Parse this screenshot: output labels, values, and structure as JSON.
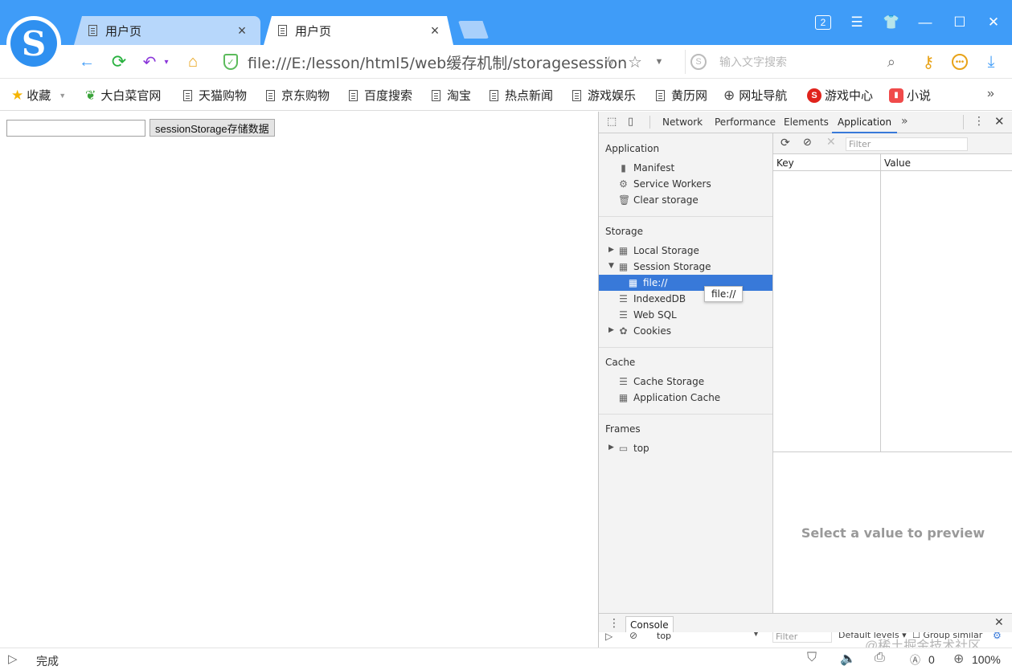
{
  "browser": {
    "tabs": [
      {
        "label": "用户页",
        "close": "×"
      },
      {
        "label": "用户页",
        "close": "×"
      }
    ],
    "window_count": "2",
    "address": {
      "url": "file:///E:/lesson/html5/web缓存机制/storagesession"
    },
    "search": {
      "placeholder": "输入文字搜索"
    },
    "bookmarks": [
      {
        "label": "收藏"
      },
      {
        "label": "大白菜官网"
      },
      {
        "label": "天猫购物"
      },
      {
        "label": "京东购物"
      },
      {
        "label": "百度搜索"
      },
      {
        "label": "淘宝"
      },
      {
        "label": "热点新闻"
      },
      {
        "label": "游戏娱乐"
      },
      {
        "label": "黄历网"
      },
      {
        "label": "网址导航"
      },
      {
        "label": "游戏中心"
      },
      {
        "label": "小说"
      }
    ],
    "status": {
      "text": "完成",
      "ad_count": "0",
      "zoom": "100%"
    }
  },
  "page": {
    "button_label": "sessionStorage存储数据",
    "input_value": ""
  },
  "devtools": {
    "tabs": [
      "Network",
      "Performance",
      "Elements",
      "Application"
    ],
    "active_tab": "Application",
    "sidebar": {
      "application": {
        "heading": "Application",
        "items": [
          "Manifest",
          "Service Workers",
          "Clear storage"
        ]
      },
      "storage": {
        "heading": "Storage",
        "items": [
          "Local Storage",
          "Session Storage",
          "file://",
          "IndexedDB",
          "Web SQL",
          "Cookies"
        ]
      },
      "cache": {
        "heading": "Cache",
        "items": [
          "Cache Storage",
          "Application Cache"
        ]
      },
      "frames": {
        "heading": "Frames",
        "items": [
          "top"
        ]
      }
    },
    "tooltip": "file://",
    "filter_placeholder": "Filter",
    "table": {
      "columns": [
        "Key",
        "Value"
      ]
    },
    "preview_text": "Select a value to preview",
    "console": {
      "tab_label": "Console",
      "context": "top",
      "filter_placeholder": "Filter",
      "levels": "Default levels ▾",
      "group": "Group similar"
    }
  },
  "watermark": "@稀土掘金技术社区",
  "colors": {
    "titlebar": "#3f9cf8",
    "selection": "#3879d9",
    "tab_inactive": "#b7d7fb"
  }
}
